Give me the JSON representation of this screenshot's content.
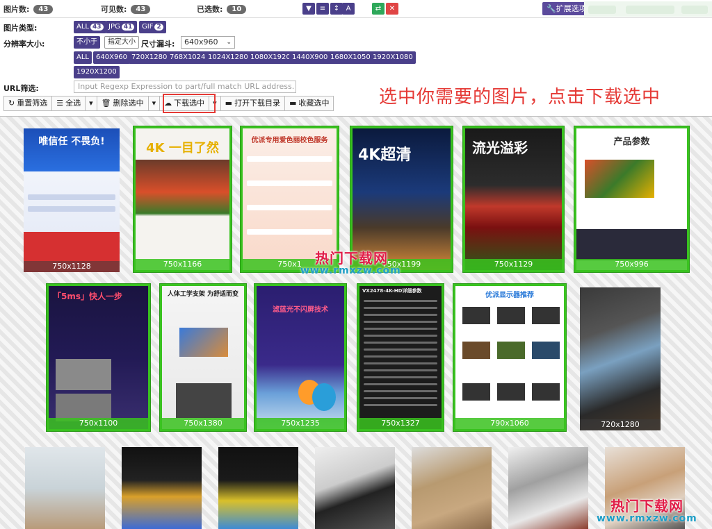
{
  "topbar": {
    "images_label": "图片数:",
    "images_count": "43",
    "visible_label": "可见数:",
    "visible_count": "43",
    "selected_label": "已选数:",
    "selected_count": "10",
    "extension_label": "扩展选项"
  },
  "filters": {
    "type_label": "图片类型:",
    "types": [
      {
        "label": "ALL",
        "count": "43"
      },
      {
        "label": "JPG",
        "count": "41"
      },
      {
        "label": "GIF",
        "count": "2"
      }
    ],
    "resolution_label": "分辨率大小:",
    "not_less_label": "不小于",
    "specify_size_label": "指定大小",
    "funnel_label": "尺寸漏斗:",
    "funnel_value": "640x960",
    "sizes_row1": [
      "ALL",
      "640X960",
      "720X1280",
      "768X1024",
      "1024X1280",
      "1080X1920",
      "1440X900",
      "1680X1050",
      "1920X1080"
    ],
    "sizes_row2": [
      "1920X1200"
    ],
    "url_label": "URL筛选:",
    "url_placeholder": "Input Regexp Expression to part/full match URL address."
  },
  "actions": {
    "reset": "重置筛选",
    "select_all": "全选",
    "delete_selected": "删除选中",
    "download_selected": "下载选中",
    "open_download_dir": "打开下载目录",
    "collect_selected": "收藏选中"
  },
  "annotation": "选中你需要的图片，点击下载选中",
  "gallery": {
    "row1": [
      {
        "size": "750x1128",
        "title": "唯信任 不畏负!"
      },
      {
        "size": "750x1166",
        "title": "4K 一目了然"
      },
      {
        "size": "750x1",
        "title": "优派专用爱色丽校色服务"
      },
      {
        "size": "750x1199",
        "title": "4K超清"
      },
      {
        "size": "750x1129",
        "title": "流光溢彩"
      },
      {
        "size": "750x996",
        "title": "产品参数"
      }
    ],
    "row2": [
      {
        "size": "750x1100",
        "title": "「5ms」快人一步"
      },
      {
        "size": "750x1380",
        "title": "人体工学支架 为舒适而变"
      },
      {
        "size": "750x1235",
        "title": "滤蓝光不闪屏技术"
      },
      {
        "size": "750x1327",
        "title": "VX2478-4K-HD详细参数"
      },
      {
        "size": "790x1060",
        "title": "优派显示器推荐"
      },
      {
        "size": "720x1280",
        "title": ""
      }
    ]
  },
  "watermarks": {
    "center_cn": "热门下载网",
    "center_url": "www.rmxzw.com",
    "corner_cn": "热门下载网",
    "corner_url": "www.rmxzw.com"
  }
}
